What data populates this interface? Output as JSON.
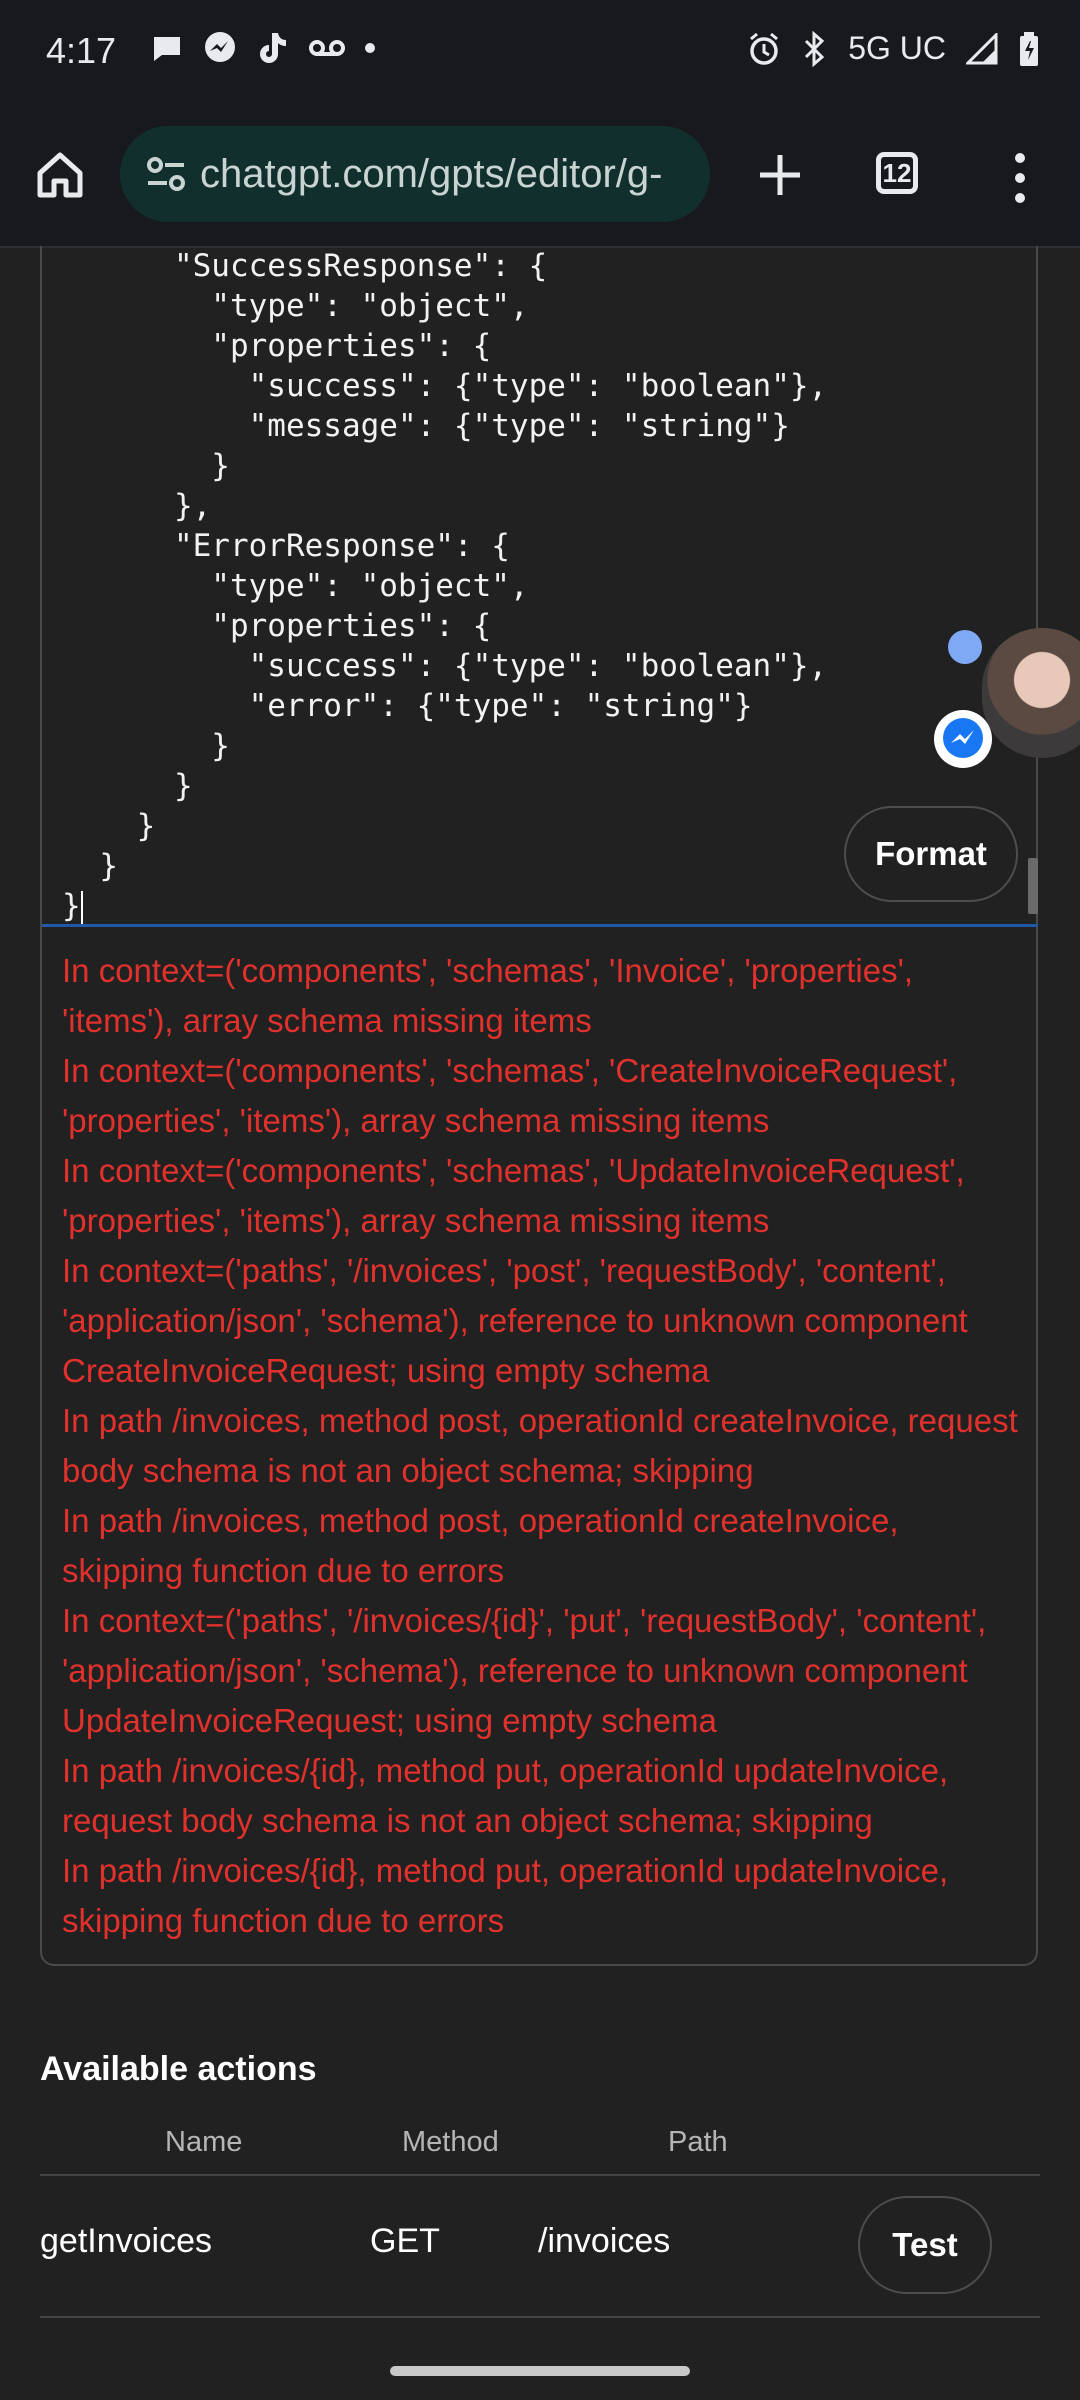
{
  "status_bar": {
    "time": "4:17",
    "network": "5G UC",
    "icons_left": [
      "chat-bubble-icon",
      "messenger-icon",
      "tiktok-icon",
      "voicemail-icon",
      "dot-icon"
    ],
    "icons_right": [
      "alarm-icon",
      "bluetooth-icon",
      "signal-icon",
      "battery-icon"
    ]
  },
  "browser": {
    "url": "chatgpt.com/gpts/editor/g-",
    "tab_count": "12"
  },
  "editor": {
    "code_lines": [
      "      \"SuccessResponse\": {",
      "        \"type\": \"object\",",
      "        \"properties\": {",
      "          \"success\": {\"type\": \"boolean\"},",
      "          \"message\": {\"type\": \"string\"}",
      "        }",
      "      },",
      "      \"ErrorResponse\": {",
      "        \"type\": \"object\",",
      "        \"properties\": {",
      "          \"success\": {\"type\": \"boolean\"},",
      "          \"error\": {\"type\": \"string\"}",
      "        }",
      "      }",
      "    }",
      "  }",
      "}"
    ],
    "format_label": "Format",
    "errors": [
      "In context=('components', 'schemas', 'Invoice', 'properties', 'items'), array schema missing items",
      "In context=('components', 'schemas', 'CreateInvoiceRequest', 'properties', 'items'), array schema missing items",
      "In context=('components', 'schemas', 'UpdateInvoiceRequest', 'properties', 'items'), array schema missing items",
      "In context=('paths', '/invoices', 'post', 'requestBody', 'content', 'application/json', 'schema'), reference to unknown component CreateInvoiceRequest; using empty schema",
      "In path /invoices, method post, operationId createInvoice, request body schema is not an object schema; skipping",
      "In path /invoices, method post, operationId createInvoice, skipping function due to errors",
      "In context=('paths', '/invoices/{id}', 'put', 'requestBody', 'content', 'application/json', 'schema'), reference to unknown component UpdateInvoiceRequest; using empty schema",
      "In path /invoices/{id}, method put, operationId updateInvoice, request body schema is not an object schema; skipping",
      "In path /invoices/{id}, method put, operationId updateInvoice, skipping function due to errors"
    ]
  },
  "actions": {
    "title": "Available actions",
    "columns": [
      "Name",
      "Method",
      "Path"
    ],
    "rows": [
      {
        "name": "getInvoices",
        "method": "GET",
        "path": "/invoices",
        "button": "Test"
      }
    ]
  },
  "colors": {
    "background": "#212121",
    "error_text": "#e0312c",
    "url_bar": "#11302d"
  }
}
